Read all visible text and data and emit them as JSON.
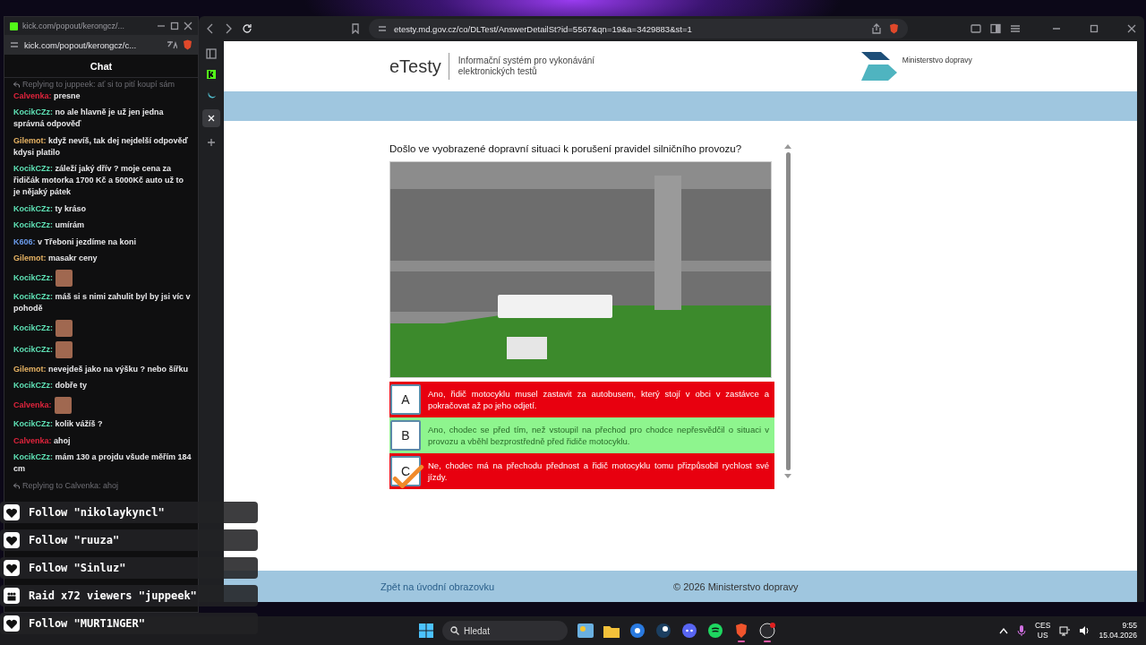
{
  "chat_window": {
    "title": "kick.com/popout/kerongcz/...",
    "address": "kick.com/popout/kerongcz/c...",
    "heading": "Chat",
    "messages": [
      {
        "kind": "reply",
        "text": "Replying to juppeek: ať si to pití koupí sám"
      },
      {
        "kind": "text",
        "user": "Calvenka:",
        "color": "#e0243c",
        "text": "presne"
      },
      {
        "kind": "text",
        "user": "KocikCZz:",
        "color": "#5ee0b4",
        "text": "no ale hlavně je už jen jedna správná odpověď"
      },
      {
        "kind": "text",
        "user": "Gilemot:",
        "color": "#e8b464",
        "text": "když nevíš, tak dej nejdelší odpověď kdysi platilo"
      },
      {
        "kind": "text",
        "user": "KocikCZz:",
        "color": "#5ee0b4",
        "text": "záleží jaký dřív ? moje cena za řidičák motorka 1700 Kč a 5000Kč auto už to je nějaký pátek"
      },
      {
        "kind": "text",
        "user": "KocikCZz:",
        "color": "#5ee0b4",
        "text": "ty kráso"
      },
      {
        "kind": "text",
        "user": "KocikCZz:",
        "color": "#5ee0b4",
        "text": "umírám"
      },
      {
        "kind": "text",
        "user": "K606:",
        "color": "#6c9cec",
        "text": "v Třeboni jezdíme na koni"
      },
      {
        "kind": "text",
        "user": "Gilemot:",
        "color": "#e8b464",
        "text": "masakr ceny"
      },
      {
        "kind": "emote",
        "user": "KocikCZz:",
        "color": "#5ee0b4"
      },
      {
        "kind": "text",
        "user": "KocikCZz:",
        "color": "#5ee0b4",
        "text": "máš si s nimi zahulit byl by jsi víc v pohodě"
      },
      {
        "kind": "emote",
        "user": "KocikCZz:",
        "color": "#5ee0b4"
      },
      {
        "kind": "emote",
        "user": "KocikCZz:",
        "color": "#5ee0b4"
      },
      {
        "kind": "text",
        "user": "Gilemot:",
        "color": "#e8b464",
        "text": "nevejdeš jako na výšku ? nebo šířku"
      },
      {
        "kind": "text",
        "user": "KocikCZz:",
        "color": "#5ee0b4",
        "text": "dobře ty"
      },
      {
        "kind": "emote",
        "user": "Calvenka:",
        "color": "#e0243c"
      },
      {
        "kind": "text",
        "user": "KocikCZz:",
        "color": "#5ee0b4",
        "text": "kolik vážíš ?"
      },
      {
        "kind": "text",
        "user": "Calvenka:",
        "color": "#e0243c",
        "text": "ahoj"
      },
      {
        "kind": "text",
        "user": "KocikCZz:",
        "color": "#5ee0b4",
        "text": "mám 130 a projdu všude měřím 184 cm"
      },
      {
        "kind": "reply",
        "text": "Replying to Calvenka: ahoj"
      }
    ]
  },
  "alerts": [
    {
      "kind": "follow",
      "text": "Follow \"nikolaykyncl\""
    },
    {
      "kind": "follow",
      "text": "Follow \"ruuza\""
    },
    {
      "kind": "follow",
      "text": "Follow \"Sinluz\""
    },
    {
      "kind": "raid",
      "text": "Raid x72 viewers \"juppeek\""
    },
    {
      "kind": "follow",
      "text": "Follow \"MURT1NGER\""
    }
  ],
  "browser": {
    "url": "etesty.md.gov.cz/co/DLTest/AnswerDetailSt?id=5567&qn=19&a=3429883&st=1"
  },
  "page": {
    "brand": "eTesty",
    "tagline": "Informační systém pro vykonávání elektronických testů",
    "ministry": "Ministerstvo dopravy",
    "question": "Došlo ve vyobrazené dopravní situaci k porušení pravidel silničního provozu?",
    "answers": [
      {
        "letter": "A",
        "text": "Ano, řidič motocyklu musel zastavit za autobusem, který stojí v obci v zastávce a pokračovat až po jeho odjetí.",
        "correct": false,
        "selected": false
      },
      {
        "letter": "B",
        "text": "Ano, chodec se před tím, než vstoupil na přechod pro chodce nepřesvědčil o situaci v provozu a vběhl bezprostředně před řidiče motocyklu.",
        "correct": true,
        "selected": false
      },
      {
        "letter": "C",
        "text": "Ne, chodec má na přechodu přednost a řidič motocyklu tomu přizpůsobil rychlost své jízdy.",
        "correct": false,
        "selected": true
      }
    ],
    "footer_link": "Zpět na úvodní obrazovku",
    "copyright": "© 2026 Ministerstvo dopravy"
  },
  "taskbar": {
    "search_placeholder": "Hledat",
    "apps": [
      {
        "kind": "widgets",
        "running": false
      },
      {
        "kind": "files",
        "running": false
      },
      {
        "kind": "copilot",
        "running": false
      },
      {
        "kind": "steam",
        "running": false
      },
      {
        "kind": "discord",
        "running": false
      },
      {
        "kind": "spotify",
        "running": false
      },
      {
        "kind": "brave",
        "running": true
      },
      {
        "kind": "obs",
        "running": true
      }
    ],
    "language": "CES",
    "layout": "US",
    "time": "9:55",
    "date": "15.04.2026"
  }
}
